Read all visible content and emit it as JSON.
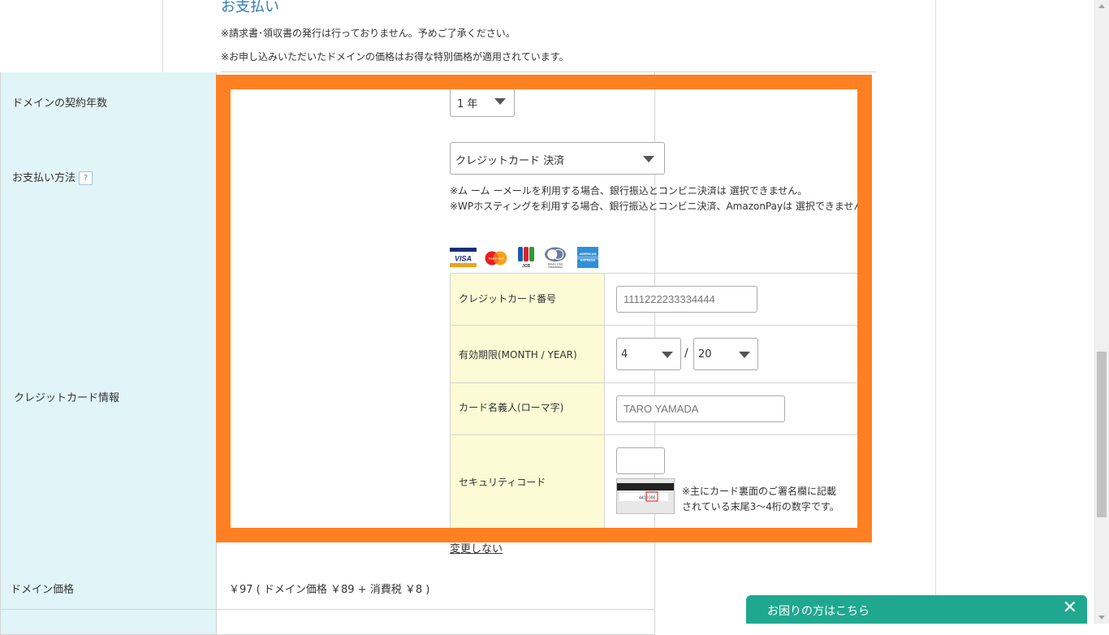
{
  "section": {
    "title": "お支払い",
    "note1": "※請求書･領収書の発行は行っておりません。予めご了承ください。",
    "note2": "※お申し込みいただいたドメインの価格はお得な特別価格が適用されています。"
  },
  "rows": {
    "contract_years": {
      "label": "ドメインの契約年数",
      "value": "1 年"
    },
    "payment_method": {
      "label": "お支払い方法",
      "help_icon": "?",
      "value": "クレジットカード 決済",
      "note1": "※ム ーム ーメールを利用する場合、銀行振込とコンビニ決済は 選択できません。",
      "note2": "※WPホスティングを利用する場合、銀行振込とコンビニ決済、AmazonPayは 選択できません。"
    },
    "card_info": {
      "label": "クレジットカード情報",
      "logos": [
        "VISA",
        "Mastercard",
        "JCB",
        "Diners Club International",
        "American Express"
      ],
      "card_number_label": "クレジットカード番号",
      "card_number_value": "1111222233334444",
      "expiry_label": "有効期限(MONTH / YEAR)",
      "expiry_month": "4",
      "expiry_separator": "/",
      "expiry_year": "20",
      "holder_label": "カード名義人(ローマ字)",
      "holder_placeholder": "TARO YAMADA",
      "cvv_label": "セキュリティコード",
      "cvv_value": "",
      "cvv_note1": "※主にカード裏面のご署名欄に記載",
      "cvv_note2": "されている末尾3～4桁の数字です。",
      "no_change_link": "変更しない"
    },
    "domain_price": {
      "label": "ドメイン価格",
      "value": "￥97 ( ドメイン価格 ￥89 + 消費税 ￥8 )"
    }
  },
  "help_bar": {
    "text": "お困りの方はこちら",
    "close": "✕"
  },
  "colors": {
    "highlight": "#ff8022",
    "label_bg": "#e1f4f8",
    "card_label_bg": "#fdfbd5",
    "help_bar": "#1fa88f"
  }
}
